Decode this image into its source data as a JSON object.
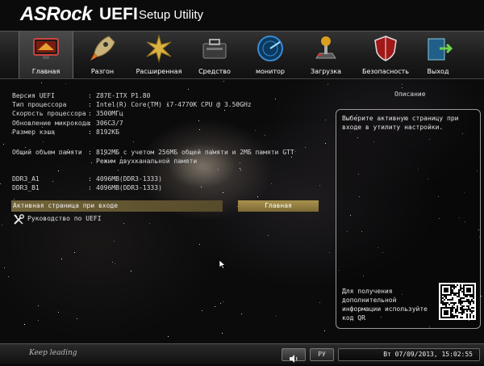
{
  "header": {
    "logo": "ASRock",
    "title": "UEFI",
    "subtitle": "Setup Utility"
  },
  "tabs": [
    {
      "label": "Главная",
      "icon": "monitor-main-icon",
      "active": true
    },
    {
      "label": "Разгон",
      "icon": "rocket-icon",
      "active": false
    },
    {
      "label": "Расширенная",
      "icon": "star-burst-icon",
      "active": false
    },
    {
      "label": "Средство",
      "icon": "toolbox-icon",
      "active": false
    },
    {
      "label": "монитор",
      "icon": "radar-icon",
      "active": false
    },
    {
      "label": "Загрузка",
      "icon": "joystick-icon",
      "active": false
    },
    {
      "label": "Безопасность",
      "icon": "shield-icon",
      "active": false
    },
    {
      "label": "Выход",
      "icon": "exit-door-icon",
      "active": false
    }
  ],
  "info": {
    "rows": [
      {
        "key": "Версия UEFI",
        "value": "Z87E-ITX P1.80"
      },
      {
        "key": "Тип процессора",
        "value": "Intel(R) Core(TM) i7-4770K CPU @ 3.50GHz"
      },
      {
        "key": "Скорость процессора",
        "value": "3500МГц"
      },
      {
        "key": "Обновление микрокода",
        "value": "306C3/7"
      },
      {
        "key": "Размер кэша",
        "value": "8192КБ"
      }
    ],
    "memory_key": "Общий объем памяти",
    "memory_value_1": "8192МБ с учетом 256МБ общей памяти и 2МБ памяти GTT",
    "memory_value_2": "Режим двухканальной памяти",
    "dimms": [
      {
        "key": "DDR3_A1",
        "value": "4096MB(DDR3-1333)"
      },
      {
        "key": "DDR3_B1",
        "value": "4096MB(DDR3-1333)"
      }
    ]
  },
  "active_page_label": "Активная страница при входе",
  "active_page_value": "Главная",
  "guide_label": "Руководство по UEFI",
  "description": {
    "title": "Описание",
    "text": "Выберите активную страницу при входе в утилиту настройки.",
    "help": "Для получения дополнительной информации используйте код QR"
  },
  "bottom": {
    "slogan": "Keep leading",
    "lang": "РУ",
    "datetime": "Вт 07/09/2013, 15:02:55"
  },
  "colors": {
    "accent_gold": "#a9924d",
    "active_bar": "#786938"
  }
}
